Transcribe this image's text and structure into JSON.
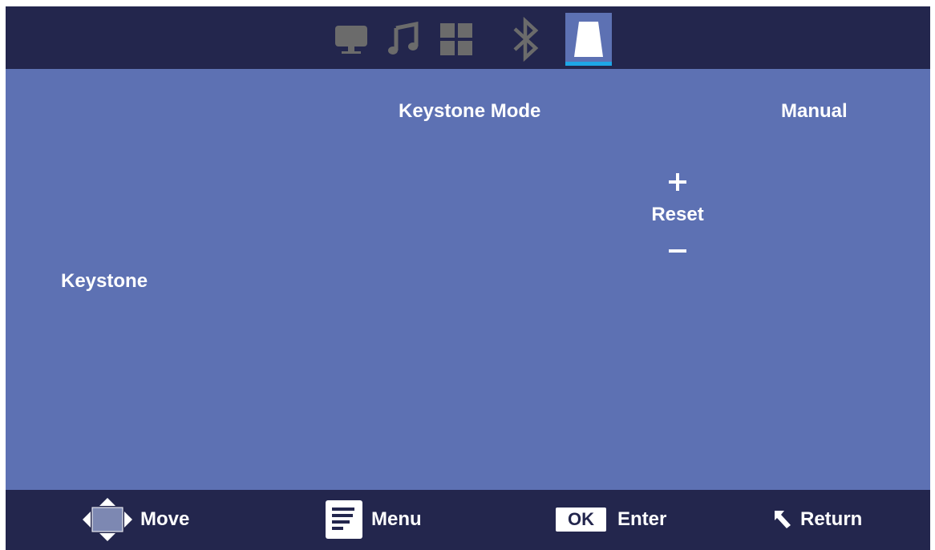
{
  "tabs": [
    {
      "icon": "monitor-icon",
      "active": false
    },
    {
      "icon": "music-note-icon",
      "active": false
    },
    {
      "icon": "apps-grid-icon",
      "active": false
    },
    {
      "icon": "bluetooth-icon",
      "active": false
    },
    {
      "icon": "keystone-icon",
      "active": true
    }
  ],
  "settings": {
    "keystone_mode_label": "Keystone Mode",
    "keystone_mode_value": "Manual",
    "keystone_label": "Keystone",
    "increase_symbol": "+",
    "reset_label": "Reset",
    "decrease_symbol": "–"
  },
  "footer": {
    "move_label": "Move",
    "menu_label": "Menu",
    "ok_badge": "OK",
    "enter_label": "Enter",
    "return_label": "Return"
  },
  "colors": {
    "bar_background": "#23264d",
    "panel_background": "#5d71b3",
    "active_underline": "#1ea6e6",
    "inactive_icon": "#6b6b6b"
  }
}
